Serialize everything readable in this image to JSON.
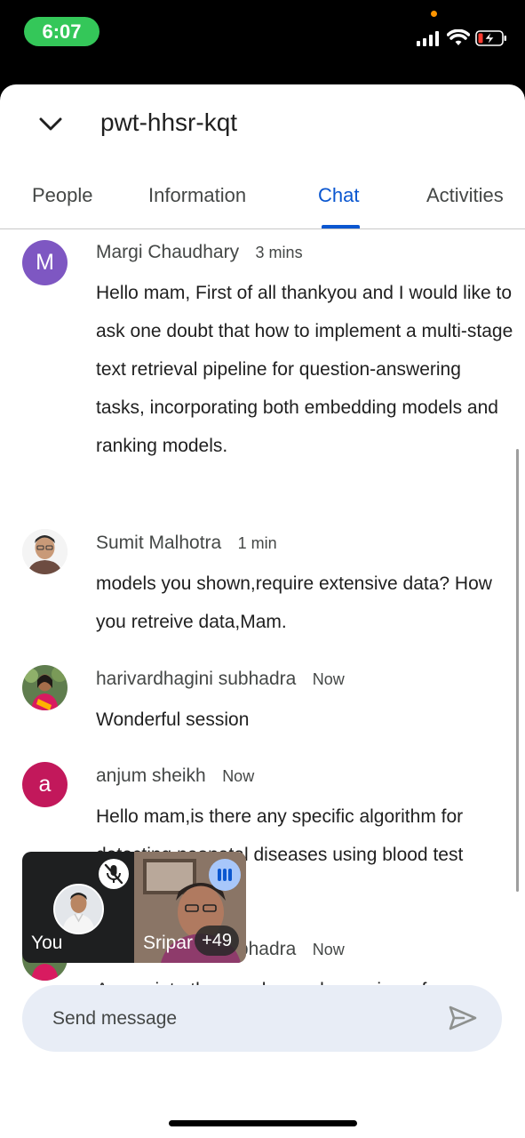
{
  "status_bar": {
    "time": "6:07"
  },
  "header": {
    "meeting_code": "pwt-hhsr-kqt"
  },
  "tabs": [
    {
      "label": "People"
    },
    {
      "label": "Information"
    },
    {
      "label": "Chat",
      "active": true
    },
    {
      "label": "Activities"
    }
  ],
  "messages": [
    {
      "sender": "Margi Chaudhary",
      "time": "3 mins",
      "avatar_letter": "M",
      "avatar_color": "#7e57c2",
      "text": "Hello mam, First of all thankyou and I would like to ask one doubt that how to implement a multi-stage text retrieval pipeline for question-answering tasks, incorporating both embedding models and ranking models."
    },
    {
      "sender": "Sumit Malhotra",
      "time": "1 min",
      "avatar_photo": "man-photo",
      "text": "models you shown,require  extensive data? How you  retreive data,Mam."
    },
    {
      "sender": "harivardhagini subhadra",
      "time": "Now",
      "avatar_photo": "woman-photo",
      "text": "Wonderful session"
    },
    {
      "sender": "anjum sheikh",
      "time": "Now",
      "avatar_letter": "a",
      "avatar_color": "#c2185b",
      "text": "Hello mam,is there any specific algorithm for detecting neonatal diseases using blood test images dataset"
    },
    {
      "sender": "harivardhagini subhadra",
      "time": "Now",
      "avatar_photo": "woman-photo",
      "text": "Appreciate the speaker and  organisers  for"
    }
  ],
  "pip": {
    "self_label": "You",
    "other_label": "Sripar",
    "others_count": "+49"
  },
  "composer": {
    "placeholder": "Send message"
  },
  "colors": {
    "accent": "#0b57d0",
    "status_green": "#34c759"
  }
}
